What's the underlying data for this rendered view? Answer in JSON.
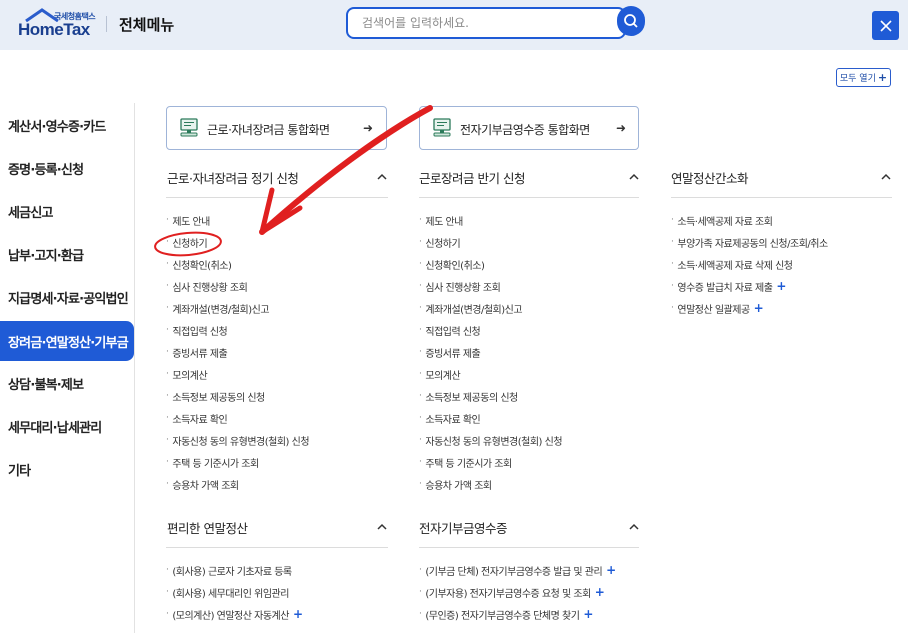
{
  "header": {
    "logo_sub": "국세청홈택스",
    "logo_main": "HomeTax",
    "title": "전체메뉴",
    "search_placeholder": "검색어를 입력하세요.",
    "open_all_label": "모두 열기",
    "open_all_plus": "+"
  },
  "sidebar": {
    "items": [
      {
        "label": "계산서·영수증·카드"
      },
      {
        "label": "증명·등록·신청"
      },
      {
        "label": "세금신고"
      },
      {
        "label": "납부·고지·환급"
      },
      {
        "label": "지급명세·자료·공익법인"
      },
      {
        "label": "장려금·연말정산·기부금"
      },
      {
        "label": "상담·불복·제보"
      },
      {
        "label": "세무대리·납세관리"
      },
      {
        "label": "기타"
      }
    ],
    "active_index": 5
  },
  "shortcuts": [
    {
      "label": "근로·자녀장려금 통합화면",
      "arrow": "➜"
    },
    {
      "label": "전자기부금영수증 통합화면",
      "arrow": "➜"
    }
  ],
  "sections": {
    "s1": {
      "title": "근로·자녀장려금 정기 신청",
      "chevron": "^",
      "items": [
        "제도 안내",
        "신청하기",
        "신청확인(취소)",
        "심사 진행상황 조회",
        "계좌개설(변경/철회)신고",
        "직접입력 신청",
        "증빙서류 제출",
        "모의계산",
        "소득정보 제공동의 신청",
        "소득자료 확인",
        "자동신청 동의 유형변경(철회) 신청",
        "주택 등 기준시가 조회",
        "승용차 가액 조회"
      ]
    },
    "s2": {
      "title": "근로장려금 반기 신청",
      "chevron": "^",
      "items": [
        "제도 안내",
        "신청하기",
        "신청확인(취소)",
        "심사 진행상황 조회",
        "계좌개설(변경/철회)신고",
        "직접입력 신청",
        "증빙서류 제출",
        "모의계산",
        "소득정보 제공동의 신청",
        "소득자료 확인",
        "자동신청 동의 유형변경(철회) 신청",
        "주택 등 기준시가 조회",
        "승용차 가액 조회"
      ]
    },
    "s3": {
      "title": "연말정산간소화",
      "chevron": "^",
      "items": [
        {
          "label": "소득·세액공제 자료 조회",
          "plus": ""
        },
        {
          "label": "부양가족 자료제공동의 신청/조회/취소",
          "plus": ""
        },
        {
          "label": "소득·세액공제 자료 삭제 신청",
          "plus": ""
        },
        {
          "label": "영수증 발급치 자료 제출",
          "plus": "+"
        },
        {
          "label": "연말정산 일괄제공",
          "plus": "+"
        }
      ]
    },
    "s4": {
      "title": "편리한 연말정산",
      "chevron": "^",
      "items": [
        {
          "label": "(회사용) 근로자 기초자료 등록",
          "plus": ""
        },
        {
          "label": "(회사용) 세무대리인 위임관리",
          "plus": ""
        },
        {
          "label": "(모의계산) 연말정산 자동계산",
          "plus": "+"
        }
      ]
    },
    "s5": {
      "title": "전자기부금영수증",
      "chevron": "^",
      "items": [
        {
          "label": "(기부금 단체) 전자기부금영수증 발급 및 관리",
          "plus": "+"
        },
        {
          "label": "(기부자용) 전자기부금영수증 요청 및 조회",
          "plus": "+"
        },
        {
          "label": "(무인증) 전자기부금영수증 단체명 찾기",
          "plus": "+"
        }
      ]
    }
  },
  "colors": {
    "brand": "#1f5bd6",
    "annotation": "#e02020"
  }
}
